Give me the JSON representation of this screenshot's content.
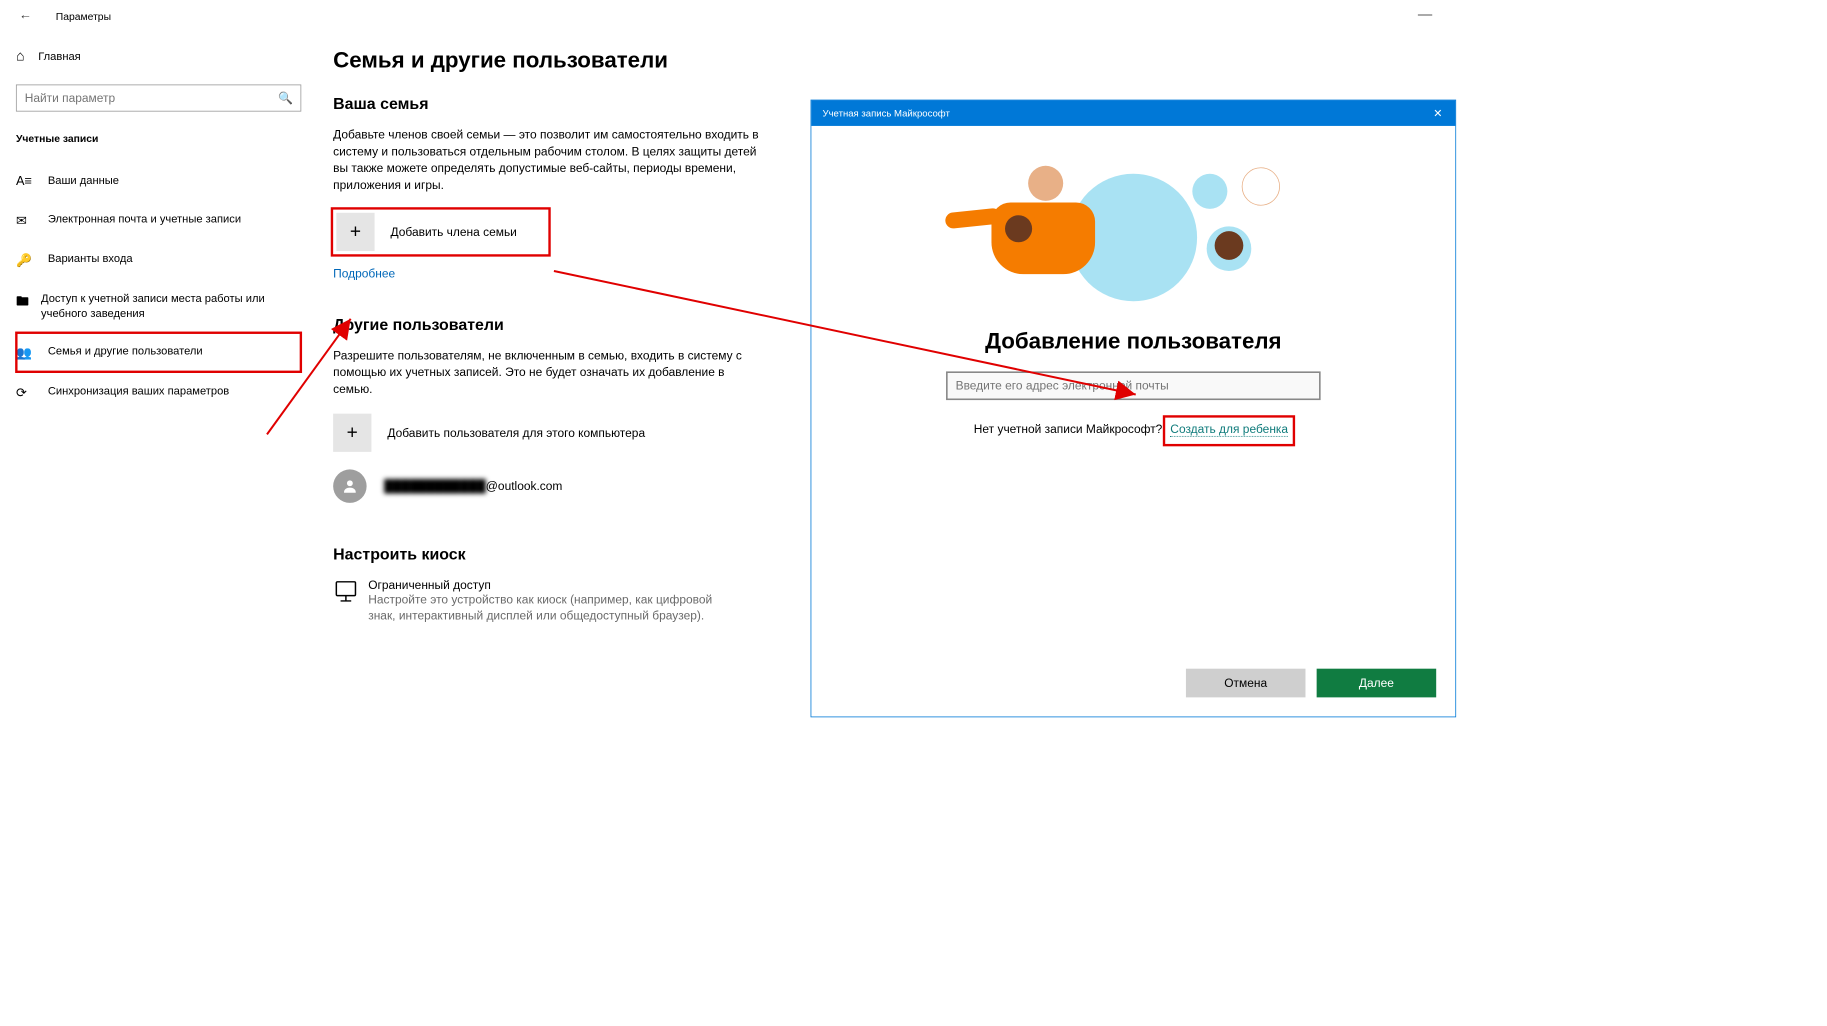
{
  "window": {
    "title": "Параметры",
    "minimize_icon": "—"
  },
  "sidebar": {
    "home": "Главная",
    "search_placeholder": "Найти параметр",
    "section": "Учетные записи",
    "items": [
      {
        "label": "Ваши данные"
      },
      {
        "label": "Электронная почта и учетные записи"
      },
      {
        "label": "Варианты входа"
      },
      {
        "label": "Доступ к учетной записи места работы или учебного заведения"
      },
      {
        "label": "Семья и другие пользователи"
      },
      {
        "label": "Синхронизация ваших параметров"
      }
    ]
  },
  "main": {
    "title": "Семья и другие пользователи",
    "family": {
      "heading": "Ваша семья",
      "desc": "Добавьте членов своей семьи — это позволит им самостоятельно входить в систему и пользоваться отдельным рабочим столом. В целях защиты детей вы также можете определять допустимые веб-сайты, периоды времени, приложения и игры.",
      "add": "Добавить члена семьи",
      "more": "Подробнее"
    },
    "others": {
      "heading": "Другие пользователи",
      "desc": "Разрешите пользователям, не включенным в семью, входить в систему с помощью их учетных записей. Это не будет означать их добавление в семью.",
      "add": "Добавить пользователя для этого компьютера",
      "user_prefix": "████████████",
      "user_suffix": "@outlook.com"
    },
    "kiosk": {
      "heading": "Настроить киоск",
      "title": "Ограниченный доступ",
      "desc": "Настройте это устройство как киоск (например, как цифровой знак, интерактивный дисплей или общедоступный браузер)."
    }
  },
  "modal": {
    "title": "Учетная запись Майкрософт",
    "heading": "Добавление пользователя",
    "email_placeholder": "Введите его адрес электронной почты",
    "no_account": "Нет учетной записи Майкрософт?",
    "create": "Создать для ребенка",
    "cancel": "Отмена",
    "next": "Далее"
  }
}
